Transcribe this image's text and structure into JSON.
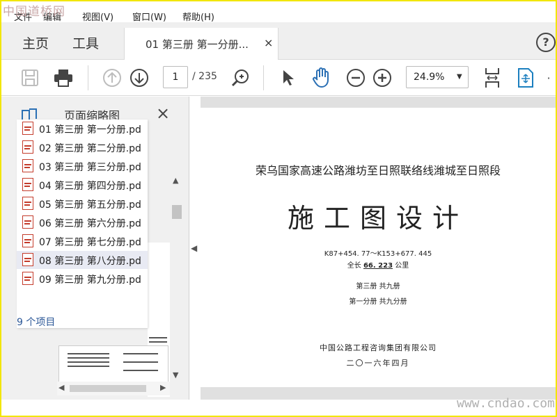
{
  "watermark": {
    "logo": "中国道桥网",
    "url": "www.cndao.com"
  },
  "menu": [
    "文件",
    "编辑",
    "视图(V)",
    "窗口(W)",
    "帮助(H)"
  ],
  "tabs": {
    "home": "主页",
    "tools": "工具",
    "document": "01 第三册 第一分册...",
    "close": "×",
    "help": "?"
  },
  "toolbar": {
    "page_current": "1",
    "page_total": "/ 235",
    "zoom": "24.9%",
    "icons": [
      "save-icon",
      "print-icon",
      "prev-page-icon",
      "next-page-icon",
      "find-icon",
      "select-cursor-icon",
      "hand-tool-icon",
      "zoom-out-icon",
      "zoom-in-icon",
      "fit-page-icon",
      "page-tools-icon"
    ]
  },
  "left_panel": {
    "title": "页面缩略图",
    "close": "×",
    "files": [
      {
        "label": "01 第三册 第一分册.pd",
        "selected": false
      },
      {
        "label": "02 第三册 第二分册.pd",
        "selected": false
      },
      {
        "label": "03 第三册 第三分册.pd",
        "selected": false
      },
      {
        "label": "04 第三册 第四分册.pd",
        "selected": false
      },
      {
        "label": "05 第三册 第五分册.pd",
        "selected": false
      },
      {
        "label": "06 第三册 第六分册.pd",
        "selected": false
      },
      {
        "label": "07 第三册 第七分册.pd",
        "selected": false
      },
      {
        "label": "08 第三册 第八分册.pd",
        "selected": true
      },
      {
        "label": "09 第三册 第九分册.pd",
        "selected": false
      }
    ],
    "item_count": "9 个项目"
  },
  "document": {
    "subtitle": "荣乌国家高速公路潍坊至日照联络线潍城至日照段",
    "title": "施工图设计",
    "range": "K87+454. 77～K153+677. 445",
    "length_prefix": "全长 ",
    "length_value": "66. 223",
    "length_unit": " 公里",
    "volume": "第三册  共九册",
    "part": "第一分册  共九分册",
    "company": "中国公路工程咨询集团有限公司",
    "date": "二〇一六年四月"
  }
}
